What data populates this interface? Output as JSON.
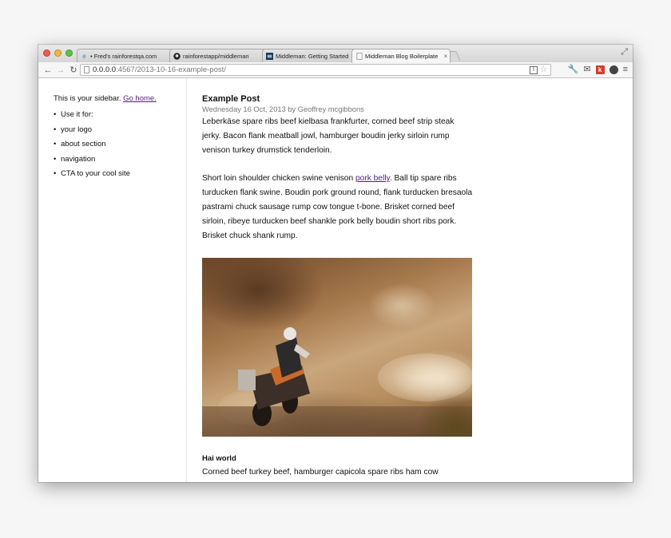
{
  "browser": {
    "tabs": [
      {
        "label": "• Fred's rainforestqa.com",
        "icon": "browser-icon",
        "active": false
      },
      {
        "label": "rainforestapp/middleman",
        "icon": "github-icon",
        "active": false
      },
      {
        "label": "Middleman: Getting Started",
        "icon": "middleman-icon",
        "active": false
      },
      {
        "label": "Middleman Blog Boilerplate",
        "icon": "page-icon",
        "active": true
      }
    ],
    "tab_close_glyph": "×",
    "url_host": "0.0.0.0",
    "url_path": ":4567/2013-10-16-example-post/"
  },
  "sidebar": {
    "intro": "This is your sidebar.",
    "home_link": "Go home.",
    "items": [
      {
        "label": "Use it for:"
      },
      {
        "label": "your logo"
      },
      {
        "label": "about section"
      },
      {
        "label": "navigation"
      },
      {
        "label": "CTA to your cool site"
      }
    ]
  },
  "post": {
    "title": "Example Post",
    "meta": "Wednesday 16 Oct, 2013 by Geoffrey mcgibbons",
    "paragraph1": "Leberkäse spare ribs beef kielbasa frankfurter, corned beef strip steak jerky. Bacon flank meatball jowl, hamburger boudin jerky sirloin rump venison turkey drumstick tenderloin.",
    "paragraph2_before": "Short loin shoulder chicken swine venison ",
    "paragraph2_link": "pork belly",
    "paragraph2_after": ". Ball tip spare ribs turducken flank swine. Boudin pork ground round, flank turducken bresaola pastrami chuck sausage rump cow tongue t-bone. Brisket corned beef sirloin, ribeye turducken beef shankle pork belly boudin short ribs pork. Brisket chuck shank rump.",
    "subheading": "Hai world",
    "paragraph3": "Corned beef turkey beef, hamburger capicola spare ribs ham cow"
  }
}
